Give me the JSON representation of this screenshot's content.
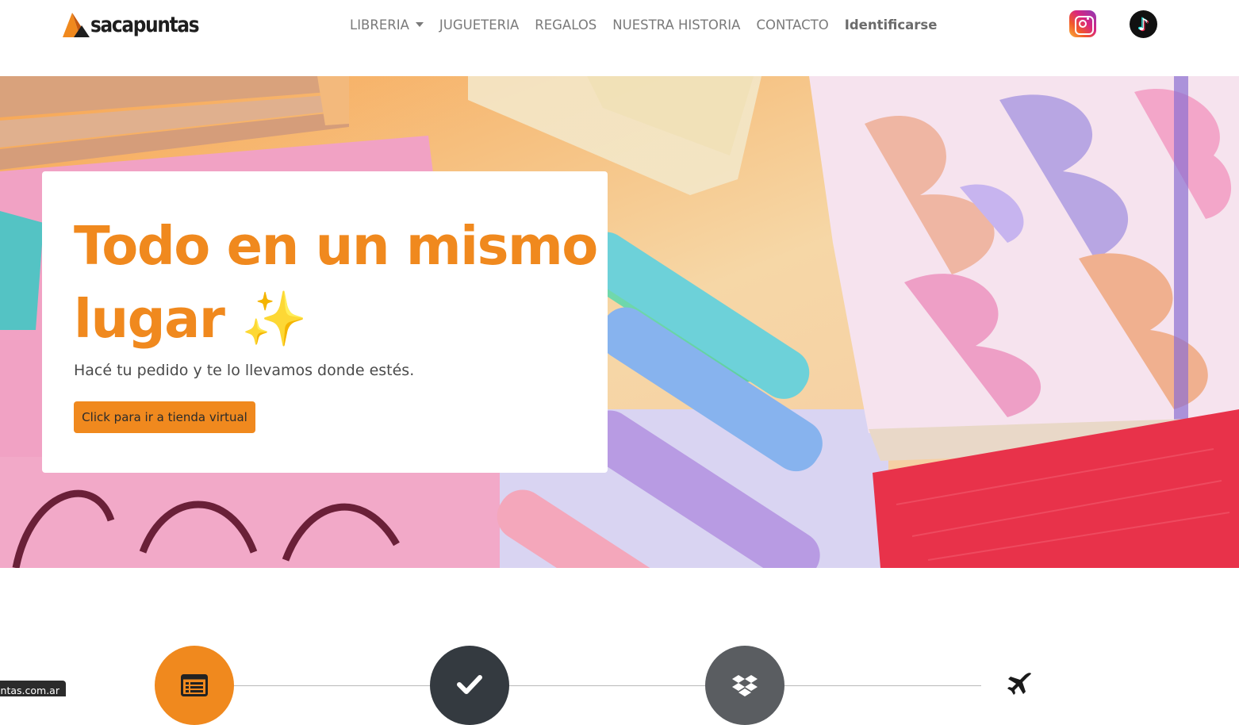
{
  "brand": {
    "name": "sacapuntas",
    "accent": "#f0891e"
  },
  "nav": {
    "items": [
      {
        "label": "LIBRERIA",
        "dropdown": true
      },
      {
        "label": "JUGUETERIA"
      },
      {
        "label": "REGALOS"
      },
      {
        "label": "NUESTRA HISTORIA"
      },
      {
        "label": "CONTACTO"
      },
      {
        "label": "Identificarse"
      }
    ]
  },
  "social": {
    "instagram_icon": "instagram-icon",
    "tiktok_icon": "tiktok-icon"
  },
  "hero": {
    "title": "Todo en un mismo lugar",
    "emoji": "✨",
    "subtitle": "Hacé tu pedido y te lo llevamos donde estés.",
    "button": "Click para ir a tienda virtual"
  },
  "steps": {
    "icons": [
      "list-icon",
      "check-icon",
      "dropbox-icon",
      "plane-icon"
    ]
  },
  "status_url": "sacapuntas.com.ar"
}
